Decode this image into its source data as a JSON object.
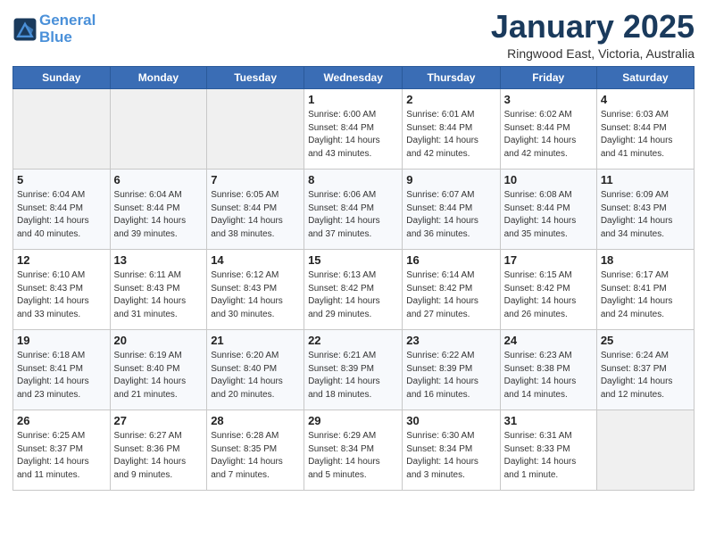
{
  "header": {
    "logo_line1": "General",
    "logo_line2": "Blue",
    "month": "January 2025",
    "location": "Ringwood East, Victoria, Australia"
  },
  "weekdays": [
    "Sunday",
    "Monday",
    "Tuesday",
    "Wednesday",
    "Thursday",
    "Friday",
    "Saturday"
  ],
  "weeks": [
    [
      {
        "day": "",
        "info": ""
      },
      {
        "day": "",
        "info": ""
      },
      {
        "day": "",
        "info": ""
      },
      {
        "day": "1",
        "info": "Sunrise: 6:00 AM\nSunset: 8:44 PM\nDaylight: 14 hours\nand 43 minutes."
      },
      {
        "day": "2",
        "info": "Sunrise: 6:01 AM\nSunset: 8:44 PM\nDaylight: 14 hours\nand 42 minutes."
      },
      {
        "day": "3",
        "info": "Sunrise: 6:02 AM\nSunset: 8:44 PM\nDaylight: 14 hours\nand 42 minutes."
      },
      {
        "day": "4",
        "info": "Sunrise: 6:03 AM\nSunset: 8:44 PM\nDaylight: 14 hours\nand 41 minutes."
      }
    ],
    [
      {
        "day": "5",
        "info": "Sunrise: 6:04 AM\nSunset: 8:44 PM\nDaylight: 14 hours\nand 40 minutes."
      },
      {
        "day": "6",
        "info": "Sunrise: 6:04 AM\nSunset: 8:44 PM\nDaylight: 14 hours\nand 39 minutes."
      },
      {
        "day": "7",
        "info": "Sunrise: 6:05 AM\nSunset: 8:44 PM\nDaylight: 14 hours\nand 38 minutes."
      },
      {
        "day": "8",
        "info": "Sunrise: 6:06 AM\nSunset: 8:44 PM\nDaylight: 14 hours\nand 37 minutes."
      },
      {
        "day": "9",
        "info": "Sunrise: 6:07 AM\nSunset: 8:44 PM\nDaylight: 14 hours\nand 36 minutes."
      },
      {
        "day": "10",
        "info": "Sunrise: 6:08 AM\nSunset: 8:44 PM\nDaylight: 14 hours\nand 35 minutes."
      },
      {
        "day": "11",
        "info": "Sunrise: 6:09 AM\nSunset: 8:43 PM\nDaylight: 14 hours\nand 34 minutes."
      }
    ],
    [
      {
        "day": "12",
        "info": "Sunrise: 6:10 AM\nSunset: 8:43 PM\nDaylight: 14 hours\nand 33 minutes."
      },
      {
        "day": "13",
        "info": "Sunrise: 6:11 AM\nSunset: 8:43 PM\nDaylight: 14 hours\nand 31 minutes."
      },
      {
        "day": "14",
        "info": "Sunrise: 6:12 AM\nSunset: 8:43 PM\nDaylight: 14 hours\nand 30 minutes."
      },
      {
        "day": "15",
        "info": "Sunrise: 6:13 AM\nSunset: 8:42 PM\nDaylight: 14 hours\nand 29 minutes."
      },
      {
        "day": "16",
        "info": "Sunrise: 6:14 AM\nSunset: 8:42 PM\nDaylight: 14 hours\nand 27 minutes."
      },
      {
        "day": "17",
        "info": "Sunrise: 6:15 AM\nSunset: 8:42 PM\nDaylight: 14 hours\nand 26 minutes."
      },
      {
        "day": "18",
        "info": "Sunrise: 6:17 AM\nSunset: 8:41 PM\nDaylight: 14 hours\nand 24 minutes."
      }
    ],
    [
      {
        "day": "19",
        "info": "Sunrise: 6:18 AM\nSunset: 8:41 PM\nDaylight: 14 hours\nand 23 minutes."
      },
      {
        "day": "20",
        "info": "Sunrise: 6:19 AM\nSunset: 8:40 PM\nDaylight: 14 hours\nand 21 minutes."
      },
      {
        "day": "21",
        "info": "Sunrise: 6:20 AM\nSunset: 8:40 PM\nDaylight: 14 hours\nand 20 minutes."
      },
      {
        "day": "22",
        "info": "Sunrise: 6:21 AM\nSunset: 8:39 PM\nDaylight: 14 hours\nand 18 minutes."
      },
      {
        "day": "23",
        "info": "Sunrise: 6:22 AM\nSunset: 8:39 PM\nDaylight: 14 hours\nand 16 minutes."
      },
      {
        "day": "24",
        "info": "Sunrise: 6:23 AM\nSunset: 8:38 PM\nDaylight: 14 hours\nand 14 minutes."
      },
      {
        "day": "25",
        "info": "Sunrise: 6:24 AM\nSunset: 8:37 PM\nDaylight: 14 hours\nand 12 minutes."
      }
    ],
    [
      {
        "day": "26",
        "info": "Sunrise: 6:25 AM\nSunset: 8:37 PM\nDaylight: 14 hours\nand 11 minutes."
      },
      {
        "day": "27",
        "info": "Sunrise: 6:27 AM\nSunset: 8:36 PM\nDaylight: 14 hours\nand 9 minutes."
      },
      {
        "day": "28",
        "info": "Sunrise: 6:28 AM\nSunset: 8:35 PM\nDaylight: 14 hours\nand 7 minutes."
      },
      {
        "day": "29",
        "info": "Sunrise: 6:29 AM\nSunset: 8:34 PM\nDaylight: 14 hours\nand 5 minutes."
      },
      {
        "day": "30",
        "info": "Sunrise: 6:30 AM\nSunset: 8:34 PM\nDaylight: 14 hours\nand 3 minutes."
      },
      {
        "day": "31",
        "info": "Sunrise: 6:31 AM\nSunset: 8:33 PM\nDaylight: 14 hours\nand 1 minute."
      },
      {
        "day": "",
        "info": ""
      }
    ]
  ]
}
